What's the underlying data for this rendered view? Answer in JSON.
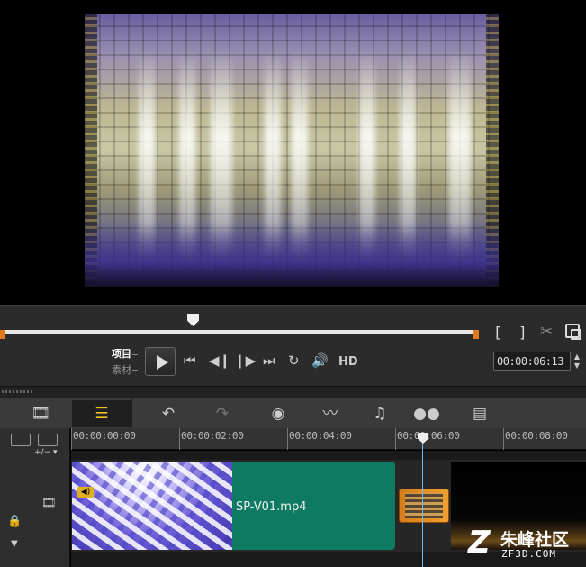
{
  "player": {
    "mode_project": "项目",
    "mode_clip": "素材",
    "mark_in": "[",
    "mark_out": "]",
    "hd_label": "HD",
    "timecode": "00:00:06:13"
  },
  "timeline": {
    "ruler_ticks": [
      "00:00:00:00",
      "00:00:02:00",
      "00:00:04:00",
      "00:00:06:00",
      "00:00:08:00"
    ],
    "add_remove_tracks_label": "+/− ▾",
    "clips": [
      {
        "label": ""
      },
      {
        "label": "SP-V01.mp4"
      },
      {
        "label": ""
      }
    ]
  },
  "watermark": {
    "logo": "Z",
    "title": "朱峰社区",
    "url": "ZF3D.COM"
  },
  "colors": {
    "accent_timeline": "#f0c020",
    "clip_green": "#0f7a62",
    "transition_orange": "#e08a20",
    "playhead_blue": "#6fb6ff",
    "scrub_marker": "#e07a1c"
  },
  "icons": {
    "storyboard": "film-strip-icon",
    "timeline": "timeline-icon",
    "undo": "undo-icon",
    "redo": "redo-icon",
    "record": "record-capture-icon",
    "audio_mixer": "audio-wave-icon",
    "auto_music": "auto-music-icon",
    "motion_tracking": "motion-tracking-icon",
    "subtitle": "subtitle-editor-icon"
  }
}
